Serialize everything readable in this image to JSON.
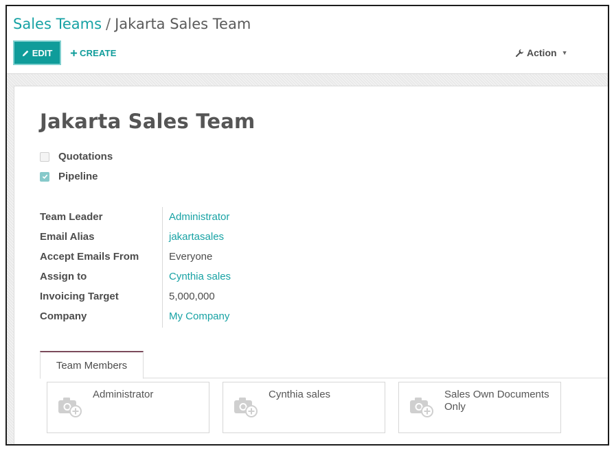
{
  "breadcrumb": {
    "parent": "Sales Teams",
    "separator": "/",
    "current": "Jakarta Sales Team"
  },
  "toolbar": {
    "edit_label": "EDIT",
    "create_label": "CREATE",
    "action_label": "Action"
  },
  "record": {
    "title": "Jakarta Sales Team",
    "options": [
      {
        "label": "Quotations",
        "checked": false
      },
      {
        "label": "Pipeline",
        "checked": true
      }
    ],
    "fields": [
      {
        "label": "Team Leader",
        "value": "Administrator",
        "link": true
      },
      {
        "label": "Email Alias",
        "value": "jakartasales",
        "link": true
      },
      {
        "label": "Accept Emails From",
        "value": "Everyone",
        "link": false
      },
      {
        "label": "Assign to",
        "value": "Cynthia sales",
        "link": true
      },
      {
        "label": "Invoicing Target",
        "value": "5,000,000",
        "link": false
      },
      {
        "label": "Company",
        "value": "My Company",
        "link": true
      }
    ]
  },
  "tabs": [
    {
      "label": "Team Members",
      "active": true
    }
  ],
  "members": [
    {
      "name": "Administrator"
    },
    {
      "name": "Cynthia sales"
    },
    {
      "name": "Sales Own Documents Only"
    }
  ],
  "icons": {
    "edit": "pencil-icon",
    "create": "plus-icon",
    "action": "wrench-icon",
    "avatar": "camera-plus-icon"
  },
  "colors": {
    "accent": "#0f9c9a",
    "link": "#17a2a4",
    "tab_top": "#7a4a5a"
  }
}
